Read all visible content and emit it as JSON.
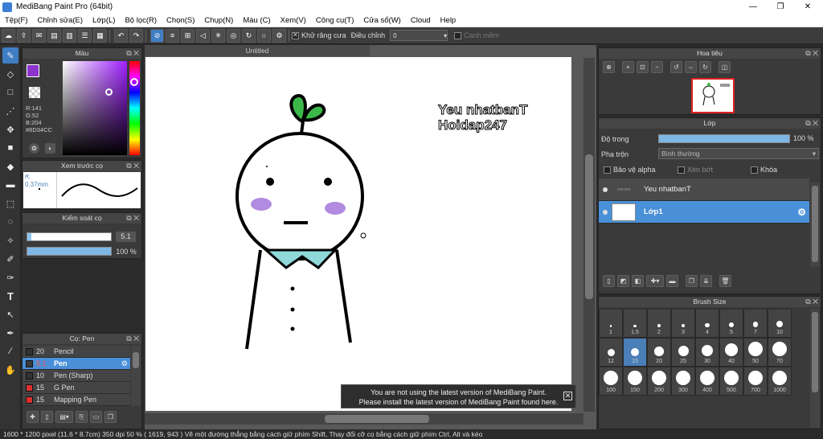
{
  "title": "MediBang Paint Pro (64bit)",
  "menu": [
    "Tệp(F)",
    "Chỉnh sửa(E)",
    "Lớp(L)",
    "Bộ lọc(R)",
    "Chọn(S)",
    "Chụp(N)",
    "Màu (C)",
    "Xem(V)",
    "Công cụ(T)",
    "Cửa sổ(W)",
    "Cloud",
    "Help"
  ],
  "toolbar": {
    "antialias_label": "Khử răng cưa",
    "adjust_label": "Điều chỉnh",
    "adjust_value": "0",
    "snap_label": "Canh mềm"
  },
  "color_panel": {
    "title": "Màu",
    "r": "R:141",
    "g": "G:52",
    "b": "B:204",
    "hex": "#8D34CC",
    "fg_color": "#8D34CC"
  },
  "brush_preview": {
    "title": "Xem trước cọ",
    "size": "0.37mm"
  },
  "brush_control": {
    "title": "Kiểm soát cọ",
    "size_value": "5.1",
    "opacity_value": "100 %",
    "size_fraction": 0.05,
    "opacity_fraction": 1.0
  },
  "brush_list": {
    "title": "Cọ: Pen",
    "items": [
      {
        "size": "20",
        "name": "Pencil",
        "color": "#333333"
      },
      {
        "size": "5.1",
        "name": "Pen",
        "color": "#3a3a3a"
      },
      {
        "size": "10",
        "name": "Pen (Sharp)",
        "color": "#333333"
      },
      {
        "size": "15",
        "name": "G Pen",
        "color": "#e03030"
      },
      {
        "size": "15",
        "name": "Mapping Pen",
        "color": "#e03030"
      }
    ]
  },
  "canvas": {
    "tab": "Untitled",
    "text_line1": "Yeu nhatbanT",
    "text_line2": "Hoidap247"
  },
  "notification": {
    "line1": "You are not using the latest version of MediBang Paint.",
    "line2": "Please install the latest version of MediBang Paint found here."
  },
  "navigator": {
    "title": "Hoa tiêu"
  },
  "layer_panel": {
    "title": "Lớp",
    "opacity_label": "Độ trong",
    "opacity_value": "100 %",
    "blend_label": "Pha trộn",
    "blend_value": "Bình thường",
    "protect_alpha": "Bảo vệ alpha",
    "clipping": "Xén bớt",
    "lock": "Khóa",
    "layers": [
      {
        "name": "Yeu nhatbanT"
      },
      {
        "name": "Lớp1"
      }
    ]
  },
  "brush_size": {
    "title": "Brush Size",
    "sizes": [
      "1",
      "1.5",
      "2",
      "3",
      "4",
      "5",
      "7",
      "10",
      "12",
      "15",
      "20",
      "25",
      "30",
      "40",
      "50",
      "70",
      "100",
      "150",
      "200",
      "300",
      "400",
      "500",
      "700",
      "1000"
    ],
    "selected": "15"
  },
  "status": "1600 * 1200 pixel   (11.6 * 8.7cm)   350 dpi   50 %   ( 1619, 943 )   Vẽ một đường thẳng bằng cách giữ phím Shift, Thay đổi cỡ cọ bằng cách giữ phím Ctrl, Alt và kéo"
}
